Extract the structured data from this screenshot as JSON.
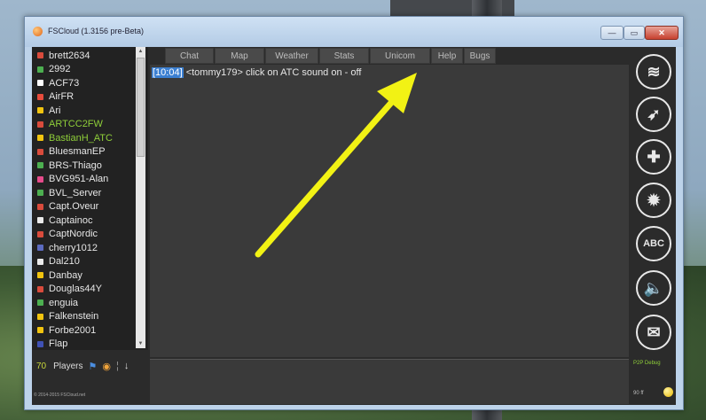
{
  "window": {
    "title": "FSCloud (1.3156 pre-Beta)",
    "min_label": "—",
    "max_label": "▭",
    "close_label": "✕"
  },
  "players": {
    "items": [
      {
        "name": "brett2634",
        "flag": "#d94b3c",
        "highlight": false
      },
      {
        "name": "2992",
        "flag": "#4caf50",
        "highlight": false
      },
      {
        "name": "ACF73",
        "flag": "#ffffff",
        "highlight": false
      },
      {
        "name": "AirFR",
        "flag": "#e74c3c",
        "highlight": false
      },
      {
        "name": "Ari",
        "flag": "#f1c40f",
        "highlight": false
      },
      {
        "name": "ARTCC2FW",
        "flag": "#d94b3c",
        "highlight": true
      },
      {
        "name": "BastianH_ATC",
        "flag": "#f1c40f",
        "highlight": true
      },
      {
        "name": "BluesmanEP",
        "flag": "#d94b3c",
        "highlight": false
      },
      {
        "name": "BRS-Thiago",
        "flag": "#4caf50",
        "highlight": false
      },
      {
        "name": "BVG951-Alan",
        "flag": "#e64b8b",
        "highlight": false
      },
      {
        "name": "BVL_Server",
        "flag": "#4caf50",
        "highlight": false
      },
      {
        "name": "Capt.Oveur",
        "flag": "#d94b3c",
        "highlight": false
      },
      {
        "name": "Captainoc",
        "flag": "#eaeaea",
        "highlight": false
      },
      {
        "name": "CaptNordic",
        "flag": "#d94b3c",
        "highlight": false
      },
      {
        "name": "cherry1012",
        "flag": "#5c6bc0",
        "highlight": false
      },
      {
        "name": "Dal210",
        "flag": "#eaeaea",
        "highlight": false
      },
      {
        "name": "Danbay",
        "flag": "#f1c40f",
        "highlight": false
      },
      {
        "name": "Douglas44Y",
        "flag": "#d94b3c",
        "highlight": false
      },
      {
        "name": "enguia",
        "flag": "#4caf50",
        "highlight": false
      },
      {
        "name": "Falkenstein",
        "flag": "#f1c40f",
        "highlight": false
      },
      {
        "name": "Forbe2001",
        "flag": "#f1c40f",
        "highlight": false
      },
      {
        "name": "Flap",
        "flag": "#3f51b5",
        "highlight": false
      }
    ],
    "count": "70",
    "label": "Players",
    "copyright": "© 2014-2015 FSCloud.net"
  },
  "tabs": [
    {
      "label": "Chat"
    },
    {
      "label": "Map"
    },
    {
      "label": "Weather"
    },
    {
      "label": "Stats"
    },
    {
      "label": "Unicom"
    },
    {
      "label": "Help"
    },
    {
      "label": "Bugs"
    }
  ],
  "chat": {
    "timestamp": "[10:04]",
    "message": "<tommy179> click on ATC sound on - off"
  },
  "right_panel": {
    "p2p_label": "P2P Debug",
    "version": "90 ff",
    "buttons": [
      {
        "name": "radio-icon",
        "glyph": "≋"
      },
      {
        "name": "compass-icon",
        "glyph": "➶"
      },
      {
        "name": "puzzle-icon",
        "glyph": "✚"
      },
      {
        "name": "gear-icon",
        "glyph": "✹"
      },
      {
        "name": "abc-icon",
        "glyph": "ABC"
      },
      {
        "name": "speaker-icon",
        "glyph": "🔈"
      },
      {
        "name": "mail-icon",
        "glyph": "✉"
      }
    ]
  },
  "colors": {
    "accent_green": "#8fcf39",
    "timestamp_blue": "#3b7fd1",
    "arrow_yellow": "#f2f214"
  }
}
